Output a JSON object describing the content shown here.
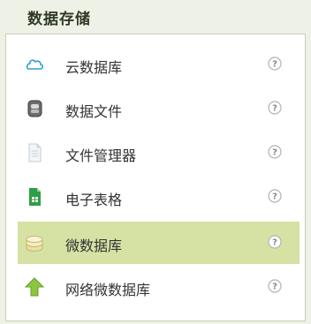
{
  "panel": {
    "title": "数据存储"
  },
  "items": [
    {
      "label": "云数据库",
      "icon": "cloud-icon",
      "help_icon": "help-icon",
      "selected": false
    },
    {
      "label": "数据文件",
      "icon": "data-file-icon",
      "help_icon": "help-icon",
      "selected": false
    },
    {
      "label": "文件管理器",
      "icon": "document-icon",
      "help_icon": "help-icon",
      "selected": false
    },
    {
      "label": "电子表格",
      "icon": "spreadsheet-icon",
      "help_icon": "help-icon",
      "selected": false
    },
    {
      "label": "微数据库",
      "icon": "database-icon",
      "help_icon": "help-icon",
      "selected": true
    },
    {
      "label": "网络微数据库",
      "icon": "up-arrow-icon",
      "help_icon": "help-icon",
      "selected": false
    }
  ],
  "colors": {
    "header_bg": "#eef1e6",
    "selected_bg": "#d5e2a4",
    "border": "#c9ceb8",
    "text": "#333333",
    "title_text": "#2f3a25"
  }
}
